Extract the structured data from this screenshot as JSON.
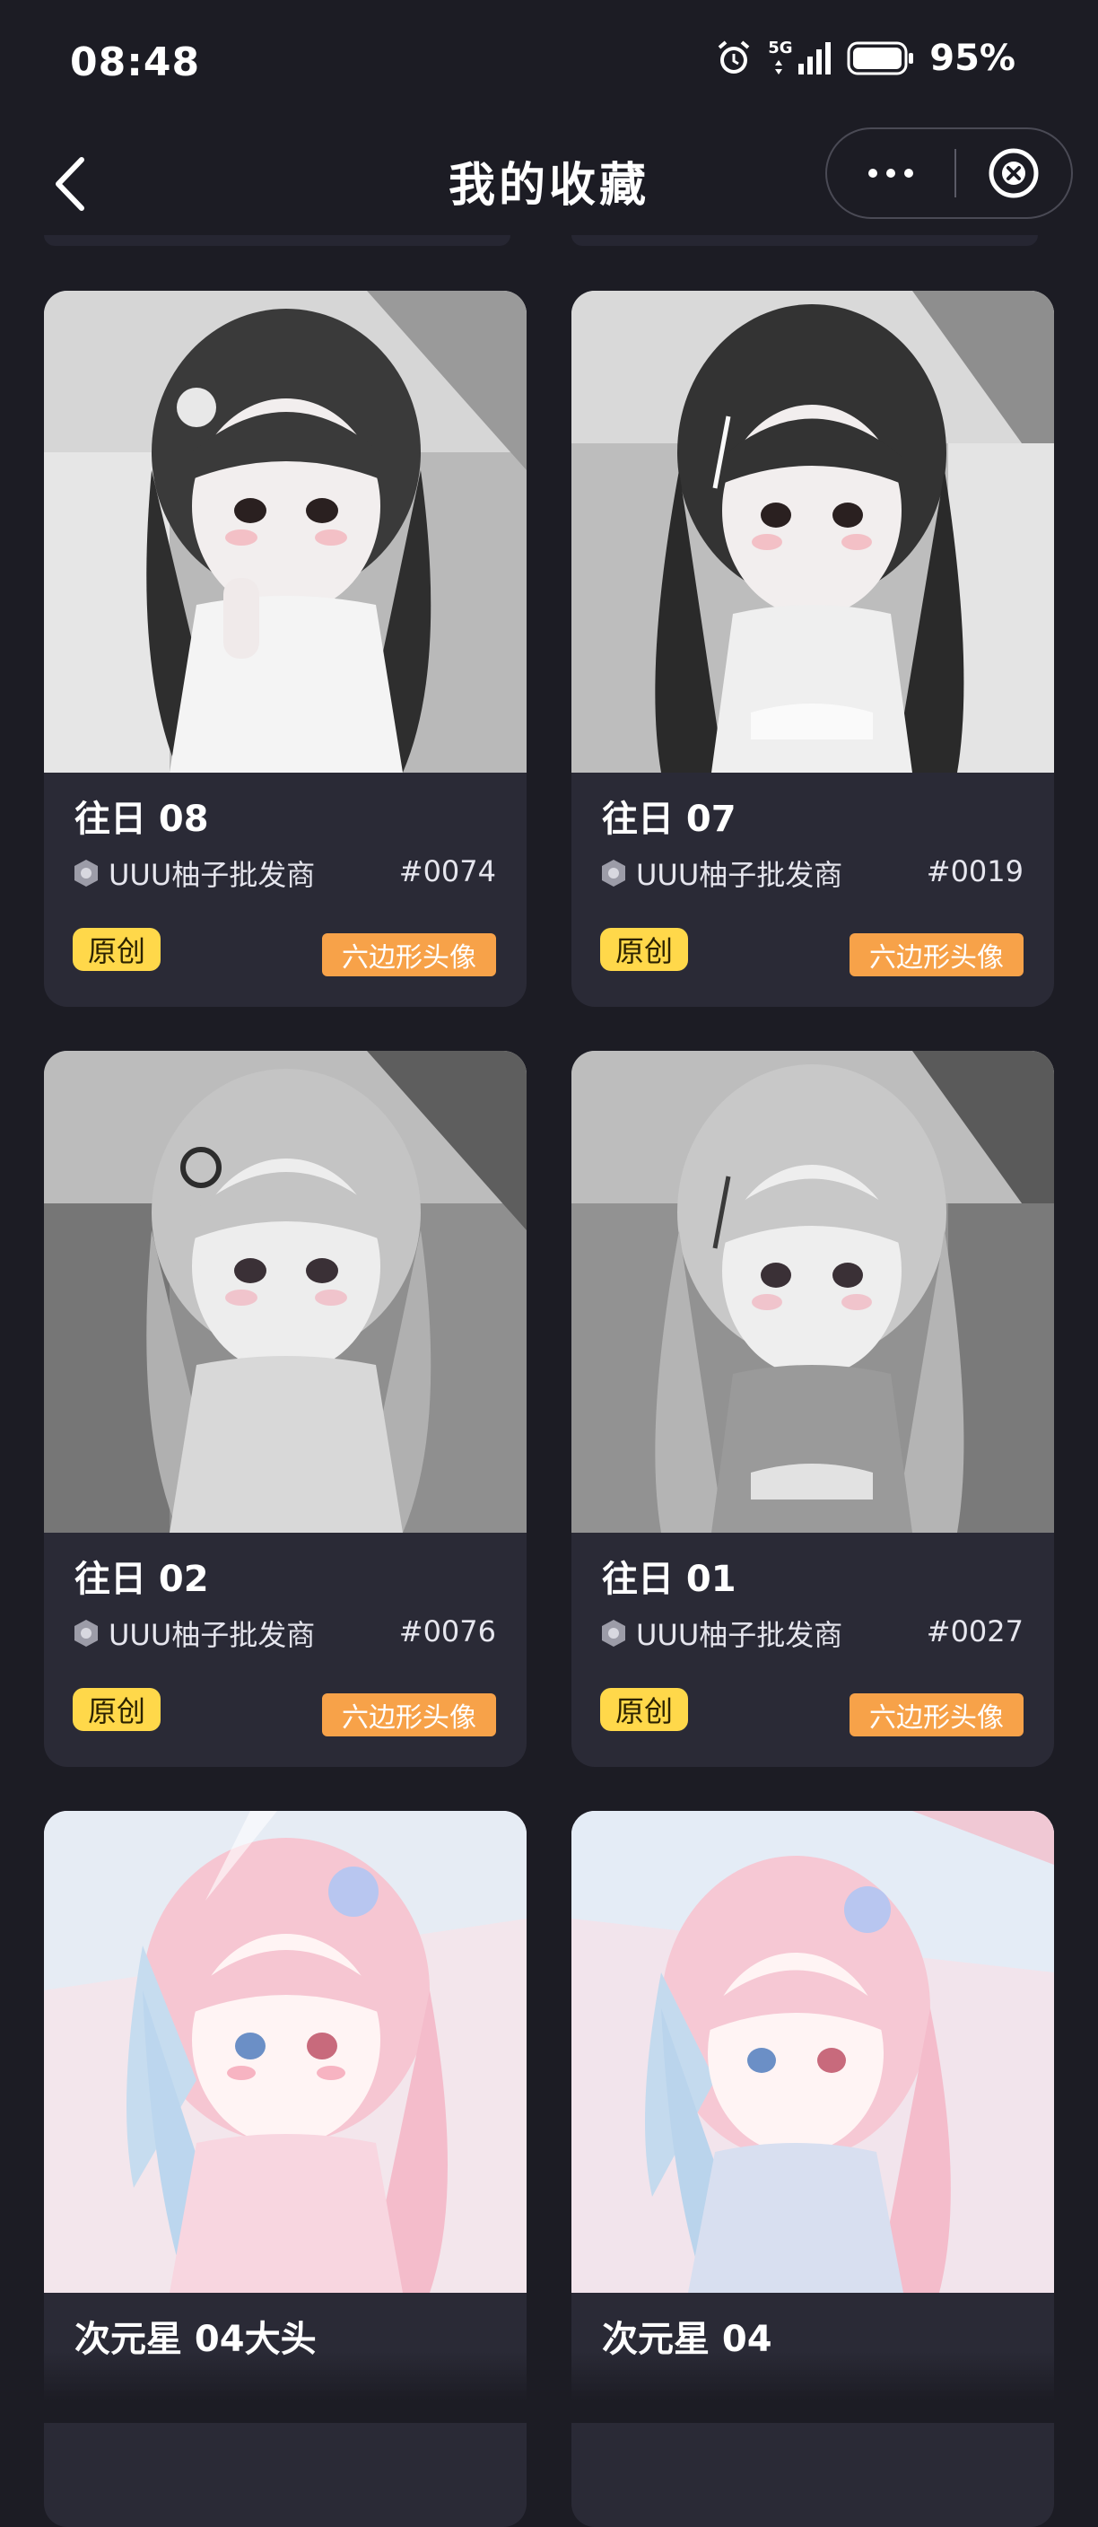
{
  "status": {
    "time": "08:48",
    "network": "5G",
    "battery": "95%"
  },
  "header": {
    "title": "我的收藏"
  },
  "cards": [
    {
      "title": "往日 08",
      "creator": "UUU柚子批发商",
      "serial": "#0074",
      "badge_original": "原创",
      "badge_type": "六边形头像",
      "theme": "mono"
    },
    {
      "title": "往日 07",
      "creator": "UUU柚子批发商",
      "serial": "#0019",
      "badge_original": "原创",
      "badge_type": "六边形头像",
      "theme": "mono"
    },
    {
      "title": "往日 02",
      "creator": "UUU柚子批发商",
      "serial": "#0076",
      "badge_original": "原创",
      "badge_type": "六边形头像",
      "theme": "grey"
    },
    {
      "title": "往日 01",
      "creator": "UUU柚子批发商",
      "serial": "#0027",
      "badge_original": "原创",
      "badge_type": "六边形头像",
      "theme": "grey"
    },
    {
      "title": "次元星 04大头",
      "theme": "pastel"
    },
    {
      "title": "次元星 04",
      "theme": "pastel"
    }
  ],
  "colors": {
    "background": "#1c1c24",
    "card": "#2a2a36",
    "badge_original": "#ffd84a",
    "badge_type": "#f7a249"
  }
}
